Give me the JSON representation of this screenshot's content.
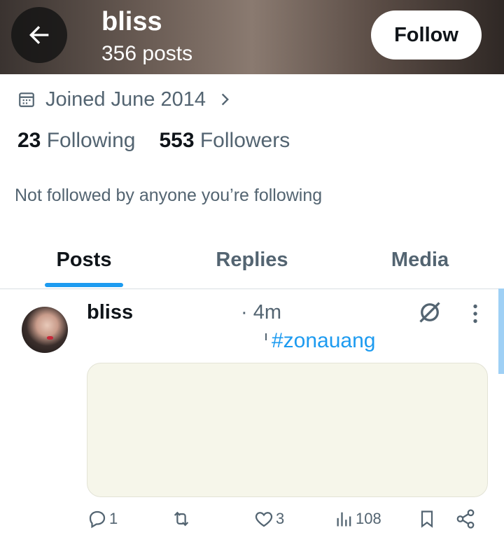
{
  "header": {
    "name": "bliss",
    "posts_count": "356 posts",
    "follow_label": "Follow"
  },
  "profile": {
    "joined": "Joined June 2014",
    "following_count": "23",
    "following_label": "Following",
    "followers_count": "553",
    "followers_label": "Followers",
    "not_followed_text": "Not followed by anyone you’re following"
  },
  "tabs": [
    {
      "label": "Posts",
      "active": true
    },
    {
      "label": "Replies",
      "active": false
    },
    {
      "label": "Media",
      "active": false
    }
  ],
  "post": {
    "author": "bliss",
    "time": "· 4m",
    "hashtag": "#zonauang",
    "replies": "1",
    "reposts": "",
    "likes": "3",
    "views": "108"
  },
  "colors": {
    "accent": "#1d9bf0",
    "secondary_text": "#536471",
    "media_placeholder": "#f6f6ea"
  },
  "icons": [
    "back-arrow-icon",
    "calendar-icon",
    "chevron-right-icon",
    "grok-icon",
    "more-icon",
    "reply-icon",
    "repost-icon",
    "like-icon",
    "views-icon",
    "bookmark-icon",
    "share-icon"
  ]
}
